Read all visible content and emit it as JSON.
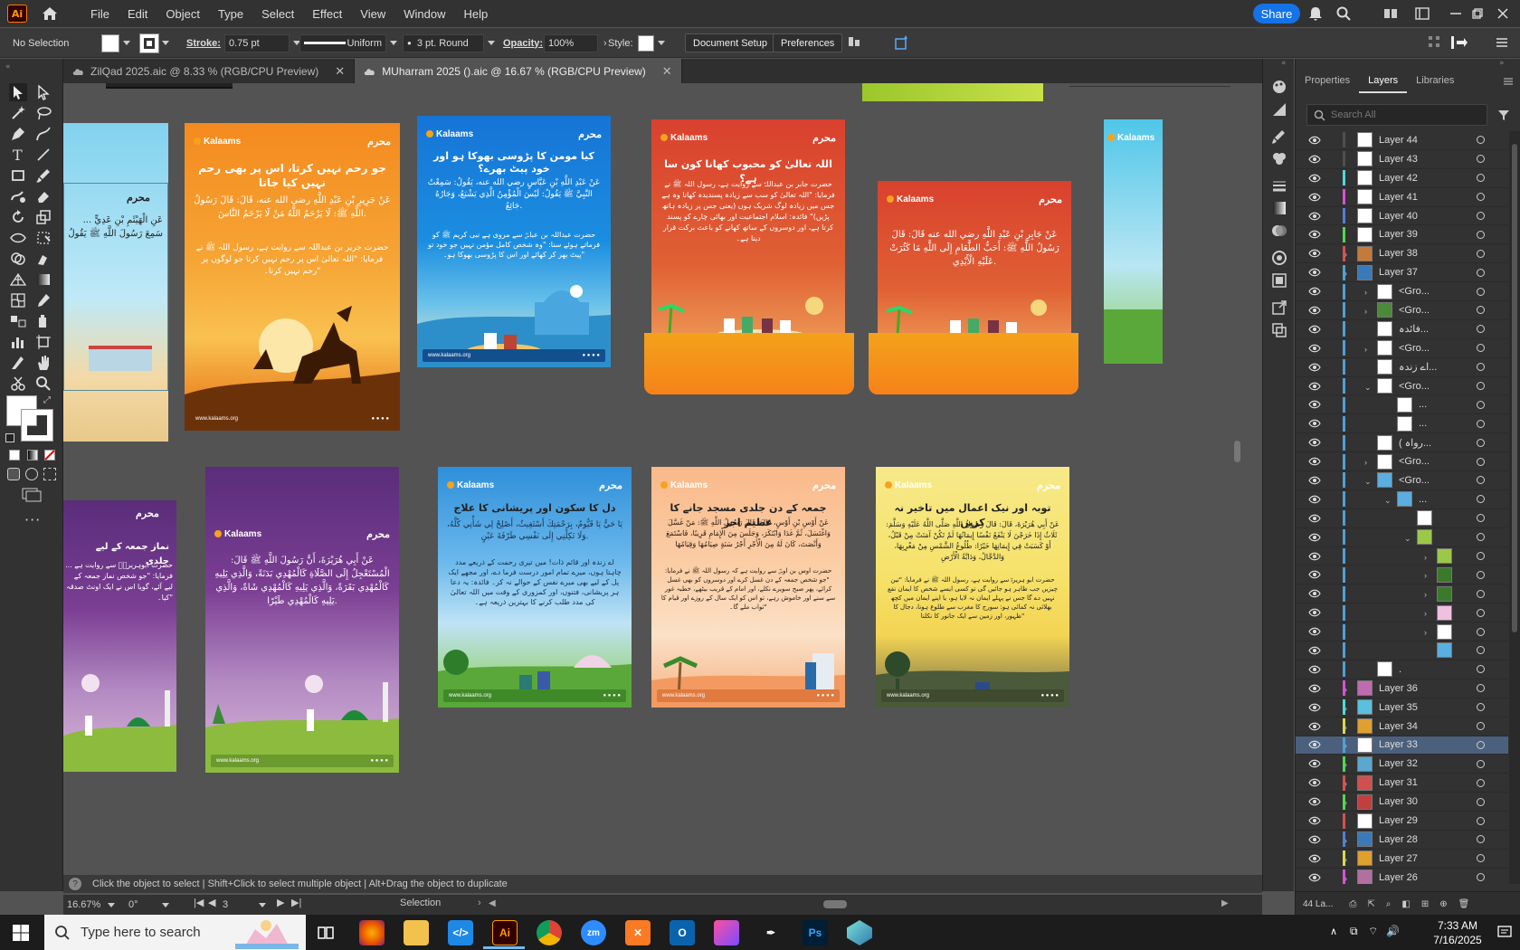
{
  "menubar": {
    "logo": "Ai",
    "items": [
      "File",
      "Edit",
      "Object",
      "Type",
      "Select",
      "Effect",
      "View",
      "Window",
      "Help"
    ],
    "share": "Share"
  },
  "controlbar": {
    "selection": "No Selection",
    "stroke_label": "Stroke:",
    "stroke_value": "0.75 pt",
    "profile": "Uniform",
    "brush": "3 pt. Round",
    "opacity_label": "Opacity:",
    "opacity_value": "100%",
    "style_label": "Style:",
    "document_setup": "Document Setup",
    "preferences": "Preferences"
  },
  "tabs": [
    {
      "label": "ZilQad 2025.aic @ 8.33 % (RGB/CPU Preview)"
    },
    {
      "label": "MUharram 2025 ().aic @ 16.67 % (RGB/CPU Preview)"
    }
  ],
  "artboards": {
    "brand": "Kalaams",
    "mark": "محرم",
    "footer": "www.kalaams.org",
    "a1": {
      "title": "",
      "arabic": "عَنِ الْهَيْثَمِ بْنِ عَدِيٍّ ... سَمِعَ رَسُولَ اللَّهِ ﷺ يَقُولُ",
      "body": ""
    },
    "a2": {
      "title": "جو رحم نہیں کرتا، اس پر بھی رحم نہیں کیا جاتا",
      "arabic": "عَنْ جَرِيرِ بْنِ عَبْدِ اللَّهِ رضي الله عنه، قَالَ: قَالَ رَسُولُ اللَّهِ ﷺ: لَا يَرْحَمُ اللَّهُ مَنْ لَا يَرْحَمُ النَّاسَ.",
      "body": "حضرت جریر بن عبداللہ سے روایت ہے، رسول اللہ ﷺ نے فرمایا: \"اللہ تعالیٰ اس پر رحم نہیں کرتا جو لوگوں پر رحم نہیں کرتا۔\""
    },
    "a3": {
      "title": "کیا مومن کا پڑوسی بھوکا ہو اور خود پیٹ بھرے؟",
      "arabic": "عَنْ عَبْدِ اللَّهِ بْنِ عَبَّاسٍ رضي الله عنه، يَقُولُ: سَمِعْتُ النَّبِيَّ ﷺ يَقُولُ: لَيْسَ الْمُؤْمِنُ الَّذِي يَشْبَعُ، وَجَارُهُ جَائِعٌ.",
      "body": "حضرت عبداللہ بن عباسؓ سے مروی ہے نبی کریم ﷺ کو فرماتے ہوئے سنا: \"وہ شخص کامل مؤمن نہیں جو خود تو پیٹ بھر کر کھائے اور اس کا پڑوسی بھوکا ہو۔\""
    },
    "a4": {
      "title": "اللہ تعالیٰ کو محبوب کھانا کون سا ہے؟",
      "arabic": "",
      "body": "حضرت جابر بن عبداللہؓ سے روایت ہے، رسول اللہ ﷺ نے فرمایا: \"اللہ تعالیٰ کو سب سے زیادہ پسندیدہ کھانا وہ ہے جس میں زیادہ لوگ شریک ہوں (یعنی جس پر زیادہ ہاتھ پڑیں)\" فائدہ: اسلام اجتماعیت اور بھائی چارے کو پسند کرتا ہے، اور دوسروں کے ساتھ کھانے کو باعث برکت قرار دیتا ہے۔"
    },
    "a5": {
      "title": "",
      "arabic": "عَنْ جَابِرِ بْنِ عَبْدِ اللَّهِ رضي الله عنه قَالَ: قَالَ رَسُولُ اللَّهِ ﷺ: أَحَبُّ الطَّعَامِ إِلَى اللَّهِ مَا كَثُرَتْ عَلَيْهِ الْأَيْدِي.",
      "body": ""
    },
    "a6": {
      "title": "",
      "arabic": "",
      "body": ""
    },
    "b1": {
      "title": "نماز جمعہ کے لیے جلدی",
      "arabic": "",
      "body": "حضرت ابوہریرہؓ سے روایت ہے ... فرمایا: \"جو شخص نماز جمعہ کے لیے آئے، گویا اس نے ایک اونٹ صدقہ کیا۔\""
    },
    "b2": {
      "title": "",
      "arabic": "عَنْ أَبِي هُرَيْرَةَ، أَنَّ رَسُولَ اللَّهِ ﷺ قَالَ: الْمُسْتَعْجِلُ إِلَى الصَّلَاةِ كَالْمُهْدِي بَدَنَةً، وَالَّذِي يَلِيهِ كَالْمُهْدِي بَقَرَةً، وَالَّذِي يَلِيهِ كَالْمُهْدِي شَاةً، وَالَّذِي يَلِيهِ كَالْمُهْدِي طَيْرًا.",
      "body": ""
    },
    "b3": {
      "title": "دل کا سکون اور پریشانی کا علاج",
      "arabic": "يَا حَيُّ يَا قَيُّومُ، بِرَحْمَتِكَ أَسْتَغِيثُ، أَصْلِحْ لِي شَأْنِي كُلَّهُ، وَلَا تَكِلْنِي إِلَى نَفْسِي طَرْفَةَ عَيْنٍ.",
      "body": "اے زندہ اور قائم ذات! میں تیری رحمت کے ذریعے مدد چاہتا ہوں، میرے تمام امور درست فرما دے، اور مجھے ایک پل کے لیے بھی میرے نفس کے حوالے نہ کر۔ فائدہ: یہ دعا ہر پریشانی، فتنوں، اور کمزوری کے وقت میں اللہ تعالیٰ کی مدد طلب کرنے کا بہترین ذریعہ ہے۔"
    },
    "b4": {
      "title": "جمعہ کے دن جلدی مسجد جانے کا عظیم اجر",
      "arabic": "عَنْ أَوْسِ بْنِ أَوْسٍ، قَالَ: قَالَ رَسُولُ اللَّهِ ﷺ: مَنْ غَسَّلَ وَاغْتَسَلَ، ثُمَّ غَدَا وَابْتَكَرَ، وَجَلَسَ مِنَ الْإِمَامِ قَرِيبًا، فَاسْتَمَعَ وَأَنْصَتَ، كَانَ لَهُ مِنَ الْأَجْرِ أَجْرُ سَنَةٍ صِيَامُهَا وَقِيَامُهَا",
      "body": "حضرت اوس بن اوسؓ سے روایت ہے کہ رسول اللہ ﷺ نے فرمایا: \"جو شخص جمعہ کے دن غسل کرے اور دوسروں کو بھی غسل کرائے، پھر صبح سویرے نکلے، اور امام کے قریب بیٹھے، خطبہ غور سے سنے اور خاموش رہے، تو اس کو ایک سال کے روزے اور قیام کا ثواب ملے گا۔\""
    },
    "b5": {
      "title": "توبہ اور نیک اعمال میں تاخیر نہ کریں",
      "arabic": "عَنْ أَبِي هُرَيْرَةَ، قَالَ: قَالَ رَسُولُ اللَّهِ صَلَّى اللَّهُ عَلَيْهِ وَسَلَّمَ: ثَلَاثٌ إِذَا خَرَجْنَ لَا يَنْفَعُ نَفْسًا إِيمَانُهَا لَمْ تَكُنْ آمَنَتْ مِنْ قَبْلُ، أَوْ كَسَبَتْ فِي إِيمَانِهَا خَيْرًا: طُلُوعُ الشَّمْسِ مِنْ مَغْرِبِهَا، وَالدَّجَّالُ، وَدَابَّةُ الْأَرْضِ",
      "body": "حضرت ابو ہریرہؓ سے روایت ہے، رسول اللہ ﷺ نے فرمایا: \"تین چیزیں جب ظاہر ہو جائیں گی تو کسی ایسے شخص کا ایمان نفع نہیں دے گا جس نے پہلے ایمان نہ لایا ہو، یا اپنے ایمان میں کچھ بھلائی نہ کمائی ہو: سورج کا مغرب سے طلوع ہونا، دجال کا ظہور، اور زمین سے ایک جانور کا نکلنا\""
    }
  },
  "statusbar": {
    "hint": "Click the object to select  |  Shift+Click to select multiple object  |  Alt+Drag the object to duplicate",
    "zoom": "16.67%",
    "angle": "0°",
    "page": "3",
    "mode": "Selection"
  },
  "panel": {
    "tabs": [
      "Properties",
      "Layers",
      "Libraries"
    ],
    "search_placeholder": "Search All",
    "footer": "44 La...",
    "layers": [
      {
        "name": "Layer 44",
        "color": "#4f4f4f",
        "indent": 0,
        "chev": false
      },
      {
        "name": "Layer 43",
        "color": "#4f4f4f",
        "indent": 0,
        "chev": false
      },
      {
        "name": "Layer 42",
        "color": "#4fd9d9",
        "indent": 0,
        "chev": false
      },
      {
        "name": "Layer 41",
        "color": "#d94fd9",
        "indent": 0,
        "chev": false
      },
      {
        "name": "Layer 40",
        "color": "#4f7fd9",
        "indent": 0,
        "chev": false
      },
      {
        "name": "Layer 39",
        "color": "#4fd94f",
        "indent": 0,
        "chev": false
      },
      {
        "name": "Layer 38",
        "color": "#d94f4f",
        "indent": 0,
        "chev": true
      },
      {
        "name": "Layer 37",
        "color": "#4f9fd9",
        "indent": 0,
        "chev": true
      },
      {
        "name": "<Gro...",
        "color": "#4f9fd9",
        "indent": 1,
        "chev": true
      },
      {
        "name": "<Gro...",
        "color": "#4f9fd9",
        "indent": 1,
        "chev": true
      },
      {
        "name": "فائدہ...",
        "color": "#4f9fd9",
        "indent": 1,
        "chev": false
      },
      {
        "name": "<Gro...",
        "color": "#4f9fd9",
        "indent": 1,
        "chev": true
      },
      {
        "name": "اے زندہ...",
        "color": "#4f9fd9",
        "indent": 1,
        "chev": false
      },
      {
        "name": "<Gro...",
        "color": "#4f9fd9",
        "indent": 1,
        "chev": true
      },
      {
        "name": "...",
        "color": "#4f9fd9",
        "indent": 2,
        "chev": false
      },
      {
        "name": "...",
        "color": "#4f9fd9",
        "indent": 2,
        "chev": false
      },
      {
        "name": "( رواہ...",
        "color": "#4f9fd9",
        "indent": 1,
        "chev": false
      },
      {
        "name": "<Gro...",
        "color": "#4f9fd9",
        "indent": 1,
        "chev": true
      },
      {
        "name": "<Gro...",
        "color": "#4f9fd9",
        "indent": 1,
        "chev": true
      },
      {
        "name": "...",
        "color": "#4f9fd9",
        "indent": 2,
        "chev": true
      },
      {
        "name": "",
        "color": "#4f9fd9",
        "indent": 3,
        "chev": false
      },
      {
        "name": "",
        "color": "#4f9fd9",
        "indent": 3,
        "chev": true
      },
      {
        "name": "",
        "color": "#4f9fd9",
        "indent": 4,
        "chev": true
      },
      {
        "name": "",
        "color": "#4f9fd9",
        "indent": 4,
        "chev": true
      },
      {
        "name": "",
        "color": "#4f9fd9",
        "indent": 4,
        "chev": true
      },
      {
        "name": "",
        "color": "#4f9fd9",
        "indent": 4,
        "chev": true
      },
      {
        "name": "",
        "color": "#4f9fd9",
        "indent": 4,
        "chev": true
      },
      {
        "name": "",
        "color": "#4f9fd9",
        "indent": 4,
        "chev": false
      },
      {
        "name": ".",
        "color": "#4f9fd9",
        "indent": 1,
        "chev": false
      },
      {
        "name": "Layer 36",
        "color": "#d94fd9",
        "indent": 0,
        "chev": true
      },
      {
        "name": "Layer 35",
        "color": "#4fd9d9",
        "indent": 0,
        "chev": true
      },
      {
        "name": "Layer 34",
        "color": "#d9d94f",
        "indent": 0,
        "chev": true
      },
      {
        "name": "Layer 33",
        "color": "#4f9fd9",
        "indent": 0,
        "chev": true,
        "selected": true
      },
      {
        "name": "Layer 32",
        "color": "#4fd94f",
        "indent": 0,
        "chev": true
      },
      {
        "name": "Layer 31",
        "color": "#d94f4f",
        "indent": 0,
        "chev": true
      },
      {
        "name": "Layer 30",
        "color": "#4fd94f",
        "indent": 0,
        "chev": true
      },
      {
        "name": "Layer 29",
        "color": "#d94f4f",
        "indent": 0,
        "chev": false
      },
      {
        "name": "Layer 28",
        "color": "#4f7fd9",
        "indent": 0,
        "chev": true
      },
      {
        "name": "Layer 27",
        "color": "#d9d94f",
        "indent": 0,
        "chev": true
      },
      {
        "name": "Layer 26",
        "color": "#d94fd9",
        "indent": 0,
        "chev": true
      }
    ]
  },
  "taskbar": {
    "search_placeholder": "Type here to search",
    "time": "7:33 AM",
    "date": "7/16/2025"
  }
}
